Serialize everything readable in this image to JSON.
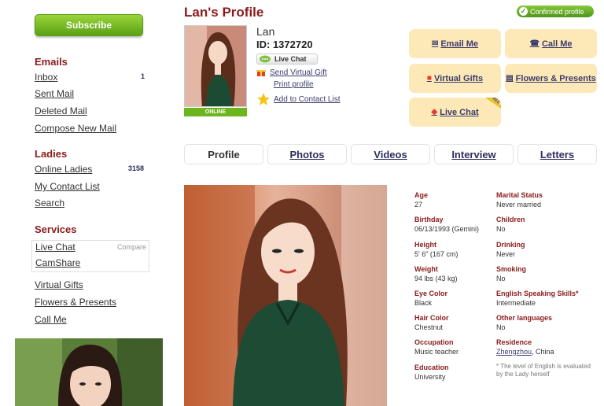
{
  "sidebar": {
    "subscribe_label": "Subscribe",
    "emails": {
      "title": "Emails",
      "items": [
        {
          "label": "Inbox",
          "count": "1"
        },
        {
          "label": "Sent Mail"
        },
        {
          "label": "Deleted Mail"
        },
        {
          "label": "Compose New Mail"
        }
      ]
    },
    "ladies": {
      "title": "Ladies",
      "items": [
        {
          "label": "Online Ladies",
          "count": "3158"
        },
        {
          "label": "My Contact List"
        },
        {
          "label": "Search"
        }
      ]
    },
    "services": {
      "title": "Services",
      "compare_label": "Compare",
      "boxed_items": [
        {
          "label": "Live Chat"
        },
        {
          "label": "CamShare"
        }
      ],
      "items": [
        {
          "label": "Virtual Gifts"
        },
        {
          "label": "Flowers & Presents"
        },
        {
          "label": "Call Me"
        }
      ]
    }
  },
  "header": {
    "title": "Lan's Profile",
    "confirmed_badge": "Confirmed profile"
  },
  "profile": {
    "name": "Lan",
    "id_text": "ID: 1372720",
    "online_badge": "ONLINE",
    "live_chat_label": "Live Chat",
    "send_gift_label": "Send Virtual Gift",
    "print_label": "Print profile",
    "add_contact_label": "Add to Contact List"
  },
  "actions": {
    "email": "Email Me",
    "call": "Call Me",
    "gifts": "Virtual Gifts",
    "flowers": "Flowers & Presents",
    "live_chat": "Live Chat",
    "free_ribbon": "FREE"
  },
  "tabs": [
    {
      "label": "Profile"
    },
    {
      "label": "Photos"
    },
    {
      "label": "Videos"
    },
    {
      "label": "Interview"
    },
    {
      "label": "Letters"
    }
  ],
  "details": {
    "left": [
      {
        "label": "Age",
        "value": "27"
      },
      {
        "label": "Birthday",
        "value": "06/13/1993 (Gemini)"
      },
      {
        "label": "Height",
        "value": "5' 6\" (167 cm)"
      },
      {
        "label": "Weight",
        "value": "94 lbs (43 kg)"
      },
      {
        "label": "Eye Color",
        "value": "Black"
      },
      {
        "label": "Hair Color",
        "value": "Chestnut"
      },
      {
        "label": "Occupation",
        "value": "Music teacher"
      },
      {
        "label": "Education",
        "value": "University"
      }
    ],
    "right": [
      {
        "label": "Marital Status",
        "value": "Never married"
      },
      {
        "label": "Children",
        "value": "No"
      },
      {
        "label": "Drinking",
        "value": "Never"
      },
      {
        "label": "Smoking",
        "value": "No"
      },
      {
        "label": "English Speaking Skills*",
        "value": "Intermediate"
      },
      {
        "label": "Other languages",
        "value": "No"
      },
      {
        "label": "Residence",
        "value_link": "Zhengzhou",
        "value_rest": ", China"
      }
    ],
    "note": "* The level of English is evaluated by the Lady herself"
  },
  "colors": {
    "accent_red": "#8b1b1b",
    "button_green": "#6bb51f",
    "action_bg": "#fde9b7"
  }
}
